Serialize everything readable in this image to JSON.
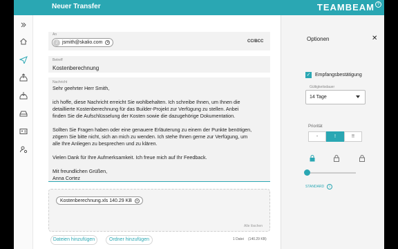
{
  "header": {
    "title": "Neuer Transfer",
    "brand": "TEAMBEAM",
    "help_icon": "help-circle-icon"
  },
  "sidebar": {
    "collapse_icon": "chevrons-right-icon",
    "items": [
      {
        "name": "home",
        "icon": "home-icon"
      },
      {
        "name": "send",
        "icon": "send-icon"
      },
      {
        "name": "upload",
        "icon": "upload-tray-icon"
      },
      {
        "name": "download",
        "icon": "download-tray-icon"
      },
      {
        "name": "drive",
        "icon": "drive-icon"
      },
      {
        "name": "contacts",
        "icon": "address-card-icon"
      },
      {
        "name": "users",
        "icon": "user-settings-icon"
      }
    ]
  },
  "form": {
    "to_label": "An",
    "recipient": {
      "initial": "J",
      "email": "jsmith@skalio.com"
    },
    "cc_bcc_label": "CC/BCC",
    "subject_label": "Betreff",
    "subject": "Kostenberechnung",
    "message_label": "Nachricht",
    "message": "Sehr geehrter Herr Smith,\n\nich hoffe, diese Nachricht erreicht Sie wohlbehalten. Ich schreibe Ihnen, um Ihnen die\ndetaillierte Kostenberechnung für das Builder-Projekt zur Verfügung zu stellen. Anbei\nfinden Sie die Aufschlüsselung der Kosten sowie die dazugehörige Dokumentation.\n\nSollten Sie Fragen haben oder eine genauere Erläuterung zu einem der Punkte benötigen,\nzögern Sie bitte nicht, sich an mich zu wenden. Ich stehe Ihnen gerne zur Verfügung, um\nalle Ihre Anliegen zu besprechen und zu klären.\n\nVielen Dank für Ihre Aufmerksamkeit. Ich freue mich auf Ihr Feedback.\n\nMit freundlichen Grüßen,\nAnna Cortez"
  },
  "attachments": {
    "file": {
      "name": "Kostenberechnung.xls",
      "size": "140.29 KB"
    },
    "drop_hint": "Alle löschen",
    "add_files_label": "Dateien hinzufügen",
    "add_folder_label": "Ordner hinzufügen",
    "count": "1 Datei",
    "total_size": "(140.29 KB)"
  },
  "options": {
    "title": "Optionen",
    "receipt_label": "Empfangsbestätigung",
    "receipt_checked": true,
    "validity_label": "Gültigkeitsdauer",
    "validity_value": "14 Tage",
    "priority_label": "Priorität",
    "priority_options": [
      "-",
      "!",
      "!!"
    ],
    "priority_selected": 1,
    "security_level_label": "STANDARD",
    "accent_color": "#2aa7b3"
  }
}
